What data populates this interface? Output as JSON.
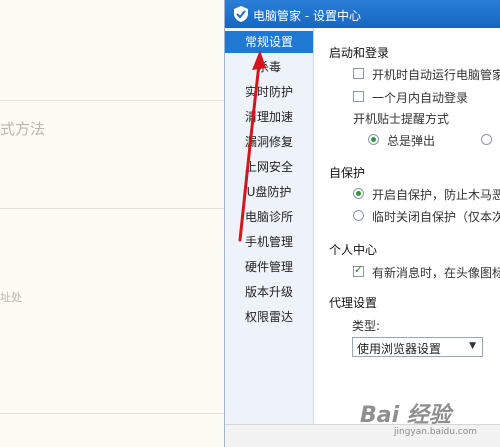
{
  "background_page": {
    "snippet_1": "式方法",
    "snippet_2": "址处"
  },
  "window": {
    "title": "电脑管家 - 设置中心",
    "brand_color": "#1f78d1"
  },
  "sidebar": {
    "items": [
      {
        "label": "常规设置",
        "active": true
      },
      {
        "label": "杀毒"
      },
      {
        "label": "实时防护"
      },
      {
        "label": "清理加速"
      },
      {
        "label": "漏洞修复"
      },
      {
        "label": "上网安全"
      },
      {
        "label": "U盘防护"
      },
      {
        "label": "电脑诊所"
      },
      {
        "label": "手机管理"
      },
      {
        "label": "硬件管理"
      },
      {
        "label": "版本升级"
      },
      {
        "label": "权限雷达"
      }
    ]
  },
  "startup": {
    "title": "启动和登录",
    "opt_autorun": "开机时自动运行电脑管家",
    "opt_autologin": "一个月内自动登录",
    "reminder_label": "开机贴士提醒方式",
    "reminder_option_1": "总是弹出"
  },
  "selfprotect": {
    "title": "自保护",
    "opt_on": "开启自保护，防止木马恶",
    "opt_off": "临时关闭自保护（仅本次"
  },
  "personal": {
    "title": "个人中心",
    "opt_newmsg": "有新消息时，在头像图标"
  },
  "proxy": {
    "title": "代理设置",
    "type_label": "类型:",
    "type_value": "使用浏览器设置"
  },
  "watermark": {
    "text": "Bai 经验",
    "sub": "jingyan.baidu.com"
  }
}
